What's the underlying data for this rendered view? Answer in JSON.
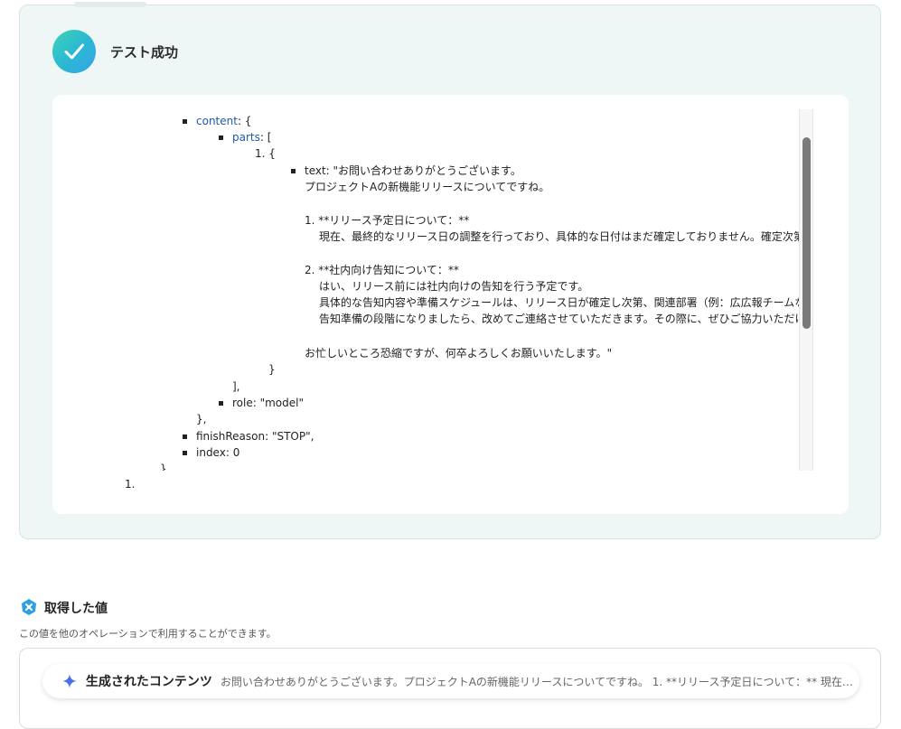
{
  "result": {
    "title": "テスト成功",
    "icon": "check-icon",
    "accent": "#2bb9d2"
  },
  "code": {
    "lines": {
      "content_key": "content",
      "content_rest": ": {",
      "parts_key": "parts",
      "parts_rest": ": [",
      "item_open": "1. {",
      "text_line": "text: \"お問い合わせありがとうございます。",
      "text_l2": "プロジェクトAの新機能リリースについてですね。",
      "item1_head": "1.  **リリース予定日について：**",
      "item1_body": "現在、最終的なリリース日の調整を行っており、具体的な日付はまだ確定しておりません。確定次第、改",
      "item2_head": "2.  **社内向け告知について：**",
      "item2_l1": "はい、リリース前には社内向けの告知を行う予定です。",
      "item2_l2": "具体的な告知内容や準備スケジュールは、リリース日が確定し次第、関連部署（例：広広報チームなど）",
      "item2_l3": "告知準備の段階になりましたら、改めてご連絡させていただきます。その際に、ぜひご協力いただければ",
      "closing": "お忙しいところ恐縮ですが、何卒よろしくお願いいたします。\"",
      "item_close": "}",
      "parts_close": "],",
      "role_line": "role: \"model\"",
      "content_close": "},",
      "finish_line": "finishReason: \"STOP\",",
      "index_line": "index: 0",
      "outer_close": "}",
      "outer_marker": "1."
    }
  },
  "values": {
    "title": "取得した値",
    "description": "この値を他のオペレーションで利用することができます。",
    "icon": "x-badge-icon",
    "items": [
      {
        "icon": "sparkle-icon",
        "label": "生成されたコンテンツ",
        "value": "お問い合わせありがとうございます。プロジェクトAの新機能リリースについてですね。 1. **リリース予定日について：** 現在、..."
      }
    ]
  }
}
